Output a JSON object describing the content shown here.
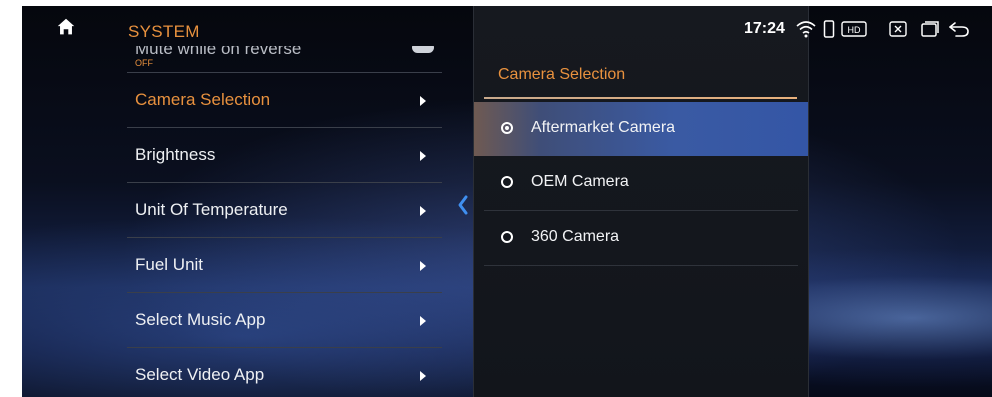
{
  "header": {
    "title": "SYSTEM"
  },
  "status": {
    "time": "17:24",
    "hd_label": "HD"
  },
  "menu": {
    "partial_item": {
      "label": "Mute while on reverse",
      "value": "OFF"
    },
    "items": [
      {
        "label": "Camera Selection",
        "active": true
      },
      {
        "label": "Brightness",
        "active": false
      },
      {
        "label": "Unit Of Temperature",
        "active": false
      },
      {
        "label": "Fuel Unit",
        "active": false
      },
      {
        "label": "Select Music App",
        "active": false
      },
      {
        "label": "Select Video App",
        "active": false
      }
    ]
  },
  "panel": {
    "title": "Camera Selection",
    "options": [
      {
        "label": "Aftermarket Camera",
        "selected": true
      },
      {
        "label": "OEM Camera",
        "selected": false
      },
      {
        "label": "360 Camera",
        "selected": false
      }
    ]
  },
  "icons": {
    "home": "home-icon",
    "wifi": "wifi-icon",
    "phone": "phone-icon",
    "hd": "hd-icon",
    "close_box": "close-box-icon",
    "recent_apps": "recent-apps-icon",
    "back": "back-icon",
    "chevron_left": "chevron-left-icon",
    "arrow_right": "arrow-right-icon"
  },
  "colors": {
    "accent": "#e8913e",
    "selected_row": "#3456a6",
    "panel_bg": "#16191f",
    "text": "#eef0f3"
  }
}
